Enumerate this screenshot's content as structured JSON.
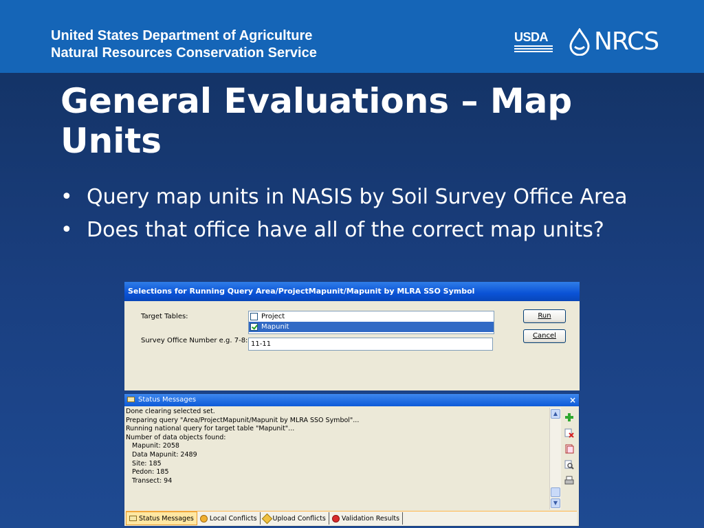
{
  "header": {
    "agency_line1": "United States Department of Agriculture",
    "agency_line2": "Natural Resources Conservation Service",
    "logo_usda": "USDA",
    "logo_nrcs": "NRCS"
  },
  "slide": {
    "title": "General Evaluations –  Map Units",
    "bullets": [
      "Query map units in NASIS by Soil Survey Office Area",
      "Does that office have all of the correct map units?"
    ]
  },
  "dialog": {
    "title": "Selections for Running Query Area/ProjectMapunit/Mapunit by MLRA SSO Symbol",
    "target_tables_label": "Target Tables:",
    "options": [
      {
        "label": "Project",
        "checked": false,
        "selected": false
      },
      {
        "label": "Mapunit",
        "checked": true,
        "selected": true
      }
    ],
    "sso_label": "Survey Office Number e.g. 7-8:",
    "sso_value": "11-11",
    "run_label": "Run",
    "cancel_label": "Cancel"
  },
  "status": {
    "title": "Status Messages",
    "close_glyph": "×",
    "log": [
      "Done clearing selected set.",
      "",
      "Preparing query \"Area/ProjectMapunit/Mapunit by MLRA SSO Symbol\"...",
      "Running national query for target table \"Mapunit\"...",
      "Number of data objects found:",
      "   Mapunit: 2058",
      "   Data Mapunit: 2489",
      "   Site: 185",
      "   Pedon: 185",
      "   Transect: 94"
    ],
    "tabs": [
      {
        "label": "Status Messages",
        "active": true
      },
      {
        "label": "Local Conflicts",
        "active": false
      },
      {
        "label": "Upload Conflicts",
        "active": false
      },
      {
        "label": "Validation Results",
        "active": false
      }
    ]
  },
  "colors": {
    "header_blue": "#1565b7",
    "bg_dark": "#12305f",
    "xp_title": "#0a52d6",
    "selection": "#316ac5"
  }
}
